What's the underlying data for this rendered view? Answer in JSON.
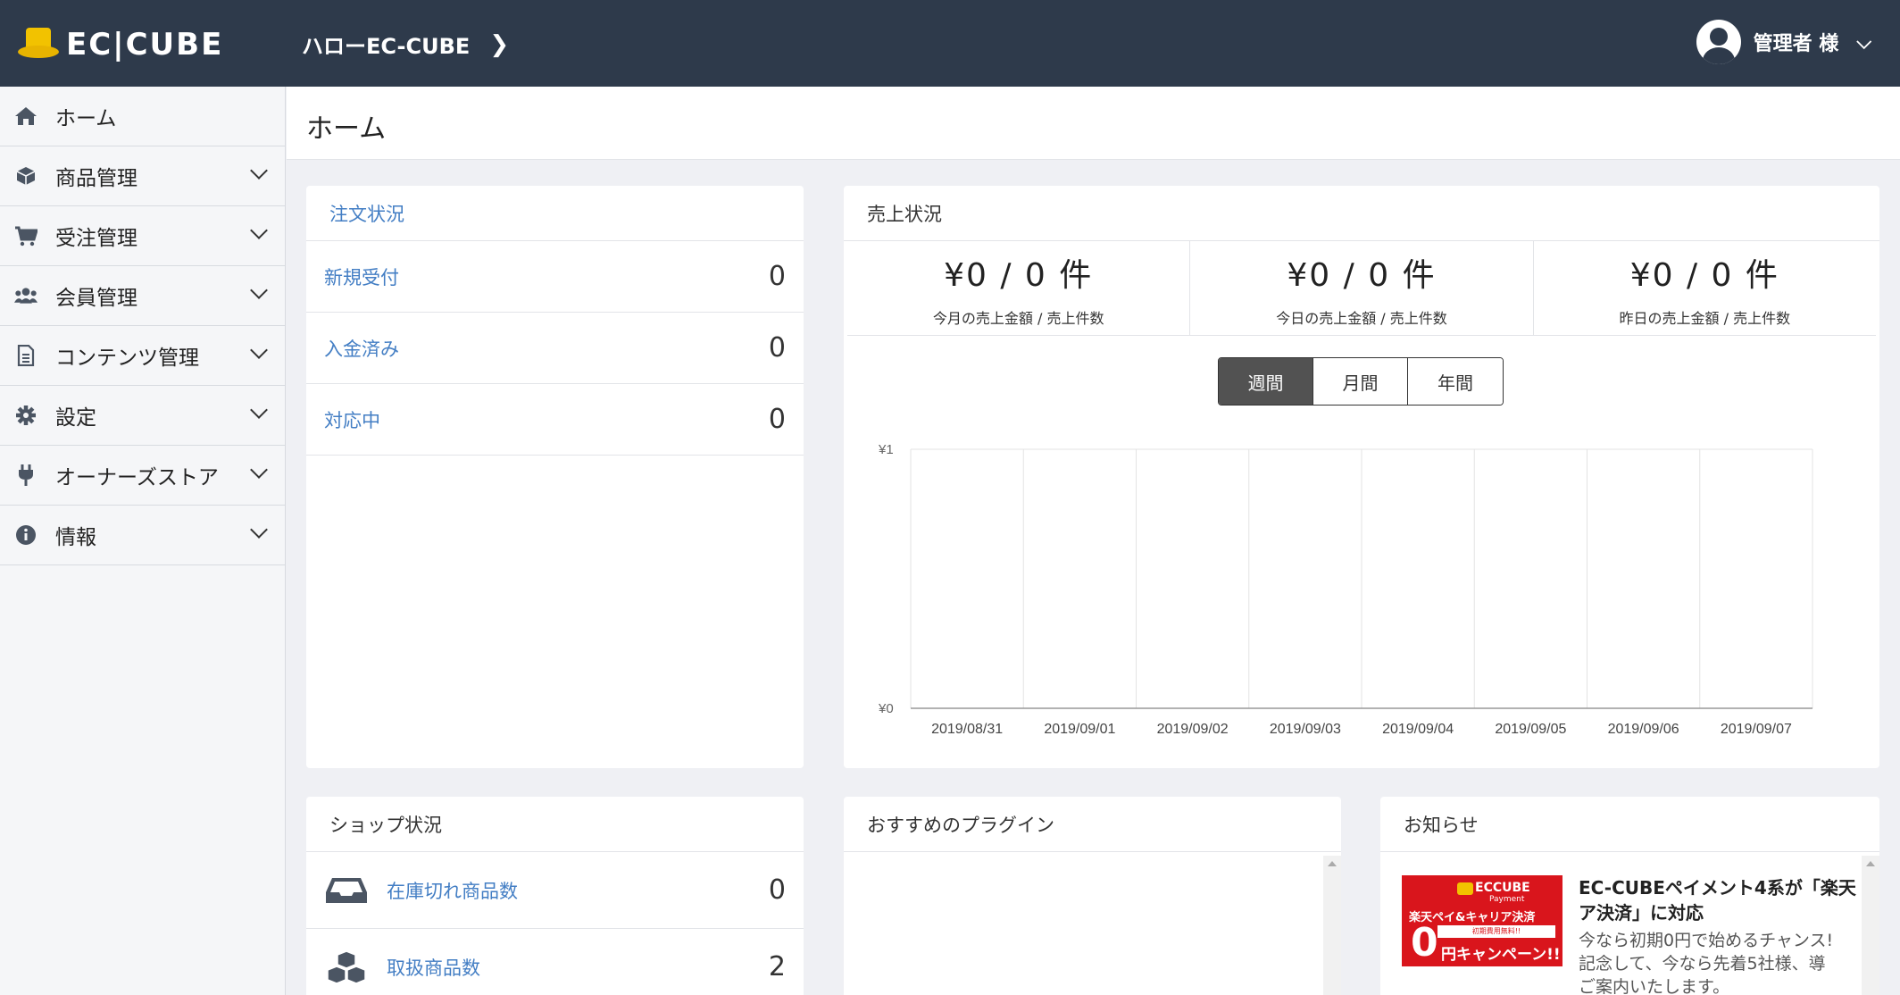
{
  "header": {
    "logo_text": "EC|CUBE",
    "shop_name": "ハローEC-CUBE",
    "user_name": "管理者 様"
  },
  "sidebar": {
    "items": [
      {
        "label": "ホーム",
        "icon": "home-icon"
      },
      {
        "label": "商品管理",
        "icon": "box-icon"
      },
      {
        "label": "受注管理",
        "icon": "cart-icon"
      },
      {
        "label": "会員管理",
        "icon": "users-icon"
      },
      {
        "label": "コンテンツ管理",
        "icon": "file-icon"
      },
      {
        "label": "設定",
        "icon": "gear-icon"
      },
      {
        "label": "オーナーズストア",
        "icon": "plug-icon"
      },
      {
        "label": "情報",
        "icon": "info-icon"
      }
    ]
  },
  "page": {
    "title": "ホーム"
  },
  "orders": {
    "title": "注文状況",
    "rows": [
      {
        "label": "新規受付",
        "value": "0"
      },
      {
        "label": "入金済み",
        "value": "0"
      },
      {
        "label": "対応中",
        "value": "0"
      }
    ]
  },
  "sales": {
    "title": "売上状況",
    "summary": [
      {
        "amount": "¥0 / 0 件",
        "caption": "今月の売上金額 / 売上件数"
      },
      {
        "amount": "¥0 / 0 件",
        "caption": "今日の売上金額 / 売上件数"
      },
      {
        "amount": "¥0 / 0 件",
        "caption": "昨日の売上金額 / 売上件数"
      }
    ],
    "periods": [
      "週間",
      "月間",
      "年間"
    ],
    "active_period": "週間"
  },
  "chart_data": {
    "type": "bar",
    "categories": [
      "2019/08/31",
      "2019/09/01",
      "2019/09/02",
      "2019/09/03",
      "2019/09/04",
      "2019/09/05",
      "2019/09/06",
      "2019/09/07"
    ],
    "values": [
      0,
      0,
      0,
      0,
      0,
      0,
      0,
      0
    ],
    "ylim": [
      0,
      1
    ],
    "y_tick_labels": [
      "¥0",
      "¥1"
    ],
    "grid": true
  },
  "shop": {
    "title": "ショップ状況",
    "rows": [
      {
        "label": "在庫切れ商品数",
        "value": "0",
        "icon": "inbox-icon"
      },
      {
        "label": "取扱商品数",
        "value": "2",
        "icon": "cubes-icon"
      }
    ]
  },
  "plugins": {
    "title": "おすすめのプラグイン"
  },
  "news": {
    "title": "お知らせ",
    "item": {
      "title": "EC-CUBEペイメント4系が「楽天\nア決済」に対応",
      "body": "今なら初期0円で始めるチャンス!\n記念して、今なら先着5社様、導\nご案内いたします。",
      "thumb": {
        "brand": "ECCUBE",
        "brand_sub": "Payment",
        "line1": "楽天ペイ&キャリア決済",
        "badge": "初期費用無料!!",
        "zero": "0",
        "campaign": "円キャンペーン!!"
      }
    }
  }
}
